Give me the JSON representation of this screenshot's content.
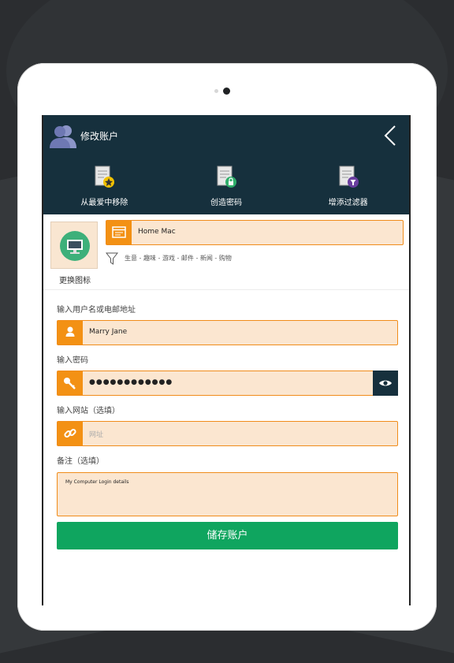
{
  "header": {
    "title": "修改账户",
    "actions": [
      {
        "label": "从最爱中移除",
        "icon": "favorite-star-doc-icon"
      },
      {
        "label": "创造密码",
        "icon": "lock-doc-icon"
      },
      {
        "label": "增添过滤器",
        "icon": "filter-doc-icon"
      }
    ]
  },
  "account": {
    "change_icon_label": "更换图标",
    "name_value": "Home Mac",
    "filters_text": "生意 - 趣味 - 游戏 - 邮件 - 新闻 - 购物"
  },
  "form": {
    "username_label": "输入用户名或电邮地址",
    "username_value": "Marry Jane",
    "password_label": "输入密码",
    "password_value": "●●●●●●●●●●●●",
    "website_label": "输入网站（选填）",
    "website_placeholder": "网址",
    "notes_label": "备注（选填）",
    "notes_value": "My Computer Login details",
    "save_label": "储存账户"
  },
  "colors": {
    "header": "#16303d",
    "accent_orange": "#f39114",
    "field_bg": "#fbe6d0",
    "save_green": "#0fa55f"
  }
}
